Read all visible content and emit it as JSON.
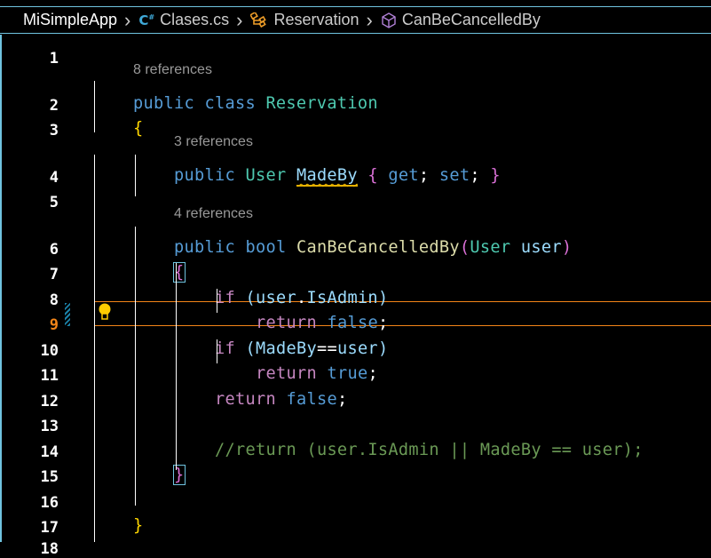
{
  "breadcrumb": [
    {
      "label": "MiSimpleApp",
      "icon": "none"
    },
    {
      "label": "Clases.cs",
      "icon": "csharp-file-icon"
    },
    {
      "label": "Reservation",
      "icon": "class-icon"
    },
    {
      "label": "CanBeCancelledBy",
      "icon": "method-icon"
    }
  ],
  "current_line": 9,
  "colors": {
    "keyword": "#569cd6",
    "type": "#4ec9b0",
    "control": "#c586c0",
    "identifier": "#9cdcfe",
    "method": "#dcdcaa",
    "comment": "#6a9955",
    "brace1": "#ffd700",
    "brace2": "#da70d6",
    "border": "#6fc3df",
    "current_line": "#f38518"
  },
  "lines": [
    {
      "n": "1",
      "indent": 0,
      "lens": "",
      "tokens": []
    },
    {
      "n": "2",
      "indent": 1,
      "lens": "8 references",
      "tokens": [
        {
          "t": "public ",
          "k": "kw"
        },
        {
          "t": "class ",
          "k": "kw"
        },
        {
          "t": "Reservation",
          "k": "ty"
        }
      ]
    },
    {
      "n": "3",
      "indent": 1,
      "lens": "",
      "tokens": [
        {
          "t": "{",
          "k": "b1"
        }
      ]
    },
    {
      "n": "4",
      "indent": 2,
      "lens": "3 references",
      "tokens": [
        {
          "t": "public ",
          "k": "kw"
        },
        {
          "t": "User ",
          "k": "ty"
        },
        {
          "t": "MadeBy",
          "k": "id squig"
        },
        {
          "t": " ",
          "k": "pl"
        },
        {
          "t": "{",
          "k": "b2"
        },
        {
          "t": " get",
          "k": "kw"
        },
        {
          "t": "; ",
          "k": "pl"
        },
        {
          "t": "set",
          "k": "kw"
        },
        {
          "t": "; ",
          "k": "pl"
        },
        {
          "t": "}",
          "k": "b2"
        }
      ]
    },
    {
      "n": "5",
      "indent": 0,
      "lens": "",
      "tokens": []
    },
    {
      "n": "6",
      "indent": 2,
      "lens": "4 references",
      "tokens": [
        {
          "t": "public ",
          "k": "kw"
        },
        {
          "t": "bool ",
          "k": "kw"
        },
        {
          "t": "CanBeCancelledBy",
          "k": "fn"
        },
        {
          "t": "(",
          "k": "b2"
        },
        {
          "t": "User ",
          "k": "ty"
        },
        {
          "t": "user",
          "k": "id"
        },
        {
          "t": ")",
          "k": "b2"
        }
      ]
    },
    {
      "n": "7",
      "indent": 2,
      "lens": "",
      "tokens": [
        {
          "t": "{",
          "k": "b2 box"
        }
      ]
    },
    {
      "n": "8",
      "indent": 3,
      "lens": "",
      "tokens": [
        {
          "t": "if ",
          "k": "ctl"
        },
        {
          "t": "(",
          "k": "id"
        },
        {
          "t": "user",
          "k": "id"
        },
        {
          "t": ".",
          "k": "pl"
        },
        {
          "t": "IsAdmin",
          "k": "id"
        },
        {
          "t": ")",
          "k": "id"
        }
      ]
    },
    {
      "n": "9",
      "indent": 4,
      "lens": "",
      "tokens": [
        {
          "t": "return ",
          "k": "ctl"
        },
        {
          "t": "false",
          "k": "kw"
        },
        {
          "t": ";",
          "k": "pl"
        }
      ]
    },
    {
      "n": "10",
      "indent": 3,
      "lens": "",
      "tokens": [
        {
          "t": "if ",
          "k": "ctl"
        },
        {
          "t": "(",
          "k": "id"
        },
        {
          "t": "MadeBy",
          "k": "id"
        },
        {
          "t": "==",
          "k": "pl"
        },
        {
          "t": "user",
          "k": "id"
        },
        {
          "t": ")",
          "k": "id"
        }
      ]
    },
    {
      "n": "11",
      "indent": 4,
      "lens": "",
      "tokens": [
        {
          "t": "return ",
          "k": "ctl"
        },
        {
          "t": "true",
          "k": "kw"
        },
        {
          "t": ";",
          "k": "pl"
        }
      ]
    },
    {
      "n": "12",
      "indent": 3,
      "lens": "",
      "tokens": [
        {
          "t": "return ",
          "k": "ctl"
        },
        {
          "t": "false",
          "k": "kw"
        },
        {
          "t": ";",
          "k": "pl"
        }
      ]
    },
    {
      "n": "13",
      "indent": 0,
      "lens": "",
      "tokens": []
    },
    {
      "n": "14",
      "indent": 3,
      "lens": "",
      "tokens": [
        {
          "t": "//return (user.IsAdmin || MadeBy == user);",
          "k": "cm"
        }
      ]
    },
    {
      "n": "15",
      "indent": 2,
      "lens": "",
      "tokens": [
        {
          "t": "}",
          "k": "b2 box"
        }
      ]
    },
    {
      "n": "16",
      "indent": 0,
      "lens": "",
      "tokens": []
    },
    {
      "n": "17",
      "indent": 1,
      "lens": "",
      "tokens": [
        {
          "t": "}",
          "k": "b1"
        }
      ]
    },
    {
      "n": "18",
      "indent": 0,
      "lens": "",
      "tokens": []
    }
  ]
}
